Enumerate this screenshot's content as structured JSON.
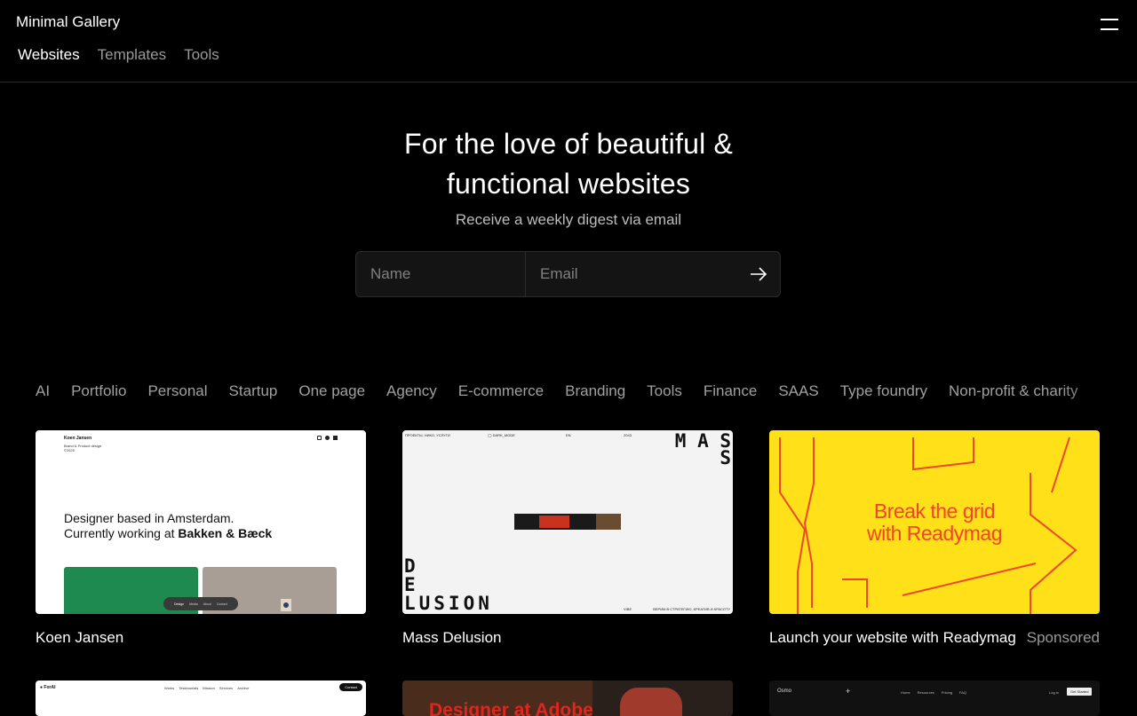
{
  "header": {
    "brand": "Minimal Gallery",
    "menu_icon": "hamburger-icon",
    "nav": [
      {
        "label": "Websites",
        "active": true
      },
      {
        "label": "Templates",
        "active": false
      },
      {
        "label": "Tools",
        "active": false
      }
    ]
  },
  "hero": {
    "title_line1": "For the love of beautiful &",
    "title_line2": "functional websites",
    "subtitle": "Receive a weekly digest via email"
  },
  "subscribe": {
    "name_placeholder": "Name",
    "email_placeholder": "Email",
    "submit_icon": "arrow-right-icon"
  },
  "filters": [
    "AI",
    "Portfolio",
    "Personal",
    "Startup",
    "One page",
    "Agency",
    "E-commerce",
    "Branding",
    "Tools",
    "Finance",
    "SAAS",
    "Type foundry",
    "Non-profit & charity"
  ],
  "cards": [
    {
      "title": "Koen Jansen",
      "preview": {
        "name": "Koen Jansen",
        "role": "Brand & Product design",
        "year": "©2025",
        "headline1": "Designer based in Amsterdam.",
        "headline2_prefix": "Currently working at ",
        "headline2_bold": "Bakken & Bæck",
        "pill": [
          "Design",
          "Media",
          "About",
          "Contact"
        ]
      }
    },
    {
      "title": "Mass Delusion",
      "preview": {
        "topline": [
          "ПРОЕКТЫ, НИКО, УСЛУГИ",
          "◯ DARK_MODE",
          "EN",
          "2043"
        ],
        "mass1": "M A S",
        "mass2": "S",
        "d": "D",
        "e": "E",
        "lusion": "LUSION",
        "bottom_left": "VIBE",
        "bottom_right": "ВЕРИМ В СТРАТЕГИЮ, КРЕАТИВ И КРАСОТУ"
      }
    },
    {
      "title": "Launch your website with Readymag",
      "sponsored": "Sponsored",
      "preview": {
        "line1": "Break the grid",
        "line2": "with Readymag",
        "bg": "#ffe019",
        "accent": "#f0452b"
      }
    }
  ],
  "row2": [
    {
      "brand": "ForAI",
      "links": [
        "Works",
        "Testimonials",
        "Mission",
        "Services",
        "Archive"
      ],
      "cta": "Contact"
    },
    {
      "headline": "Designer at Adobe"
    },
    {
      "brand": "Osmo",
      "links": [
        "Home",
        "Resources",
        "Pricing",
        "FAQ"
      ],
      "login": "Log in",
      "cta": "Get Started"
    }
  ]
}
